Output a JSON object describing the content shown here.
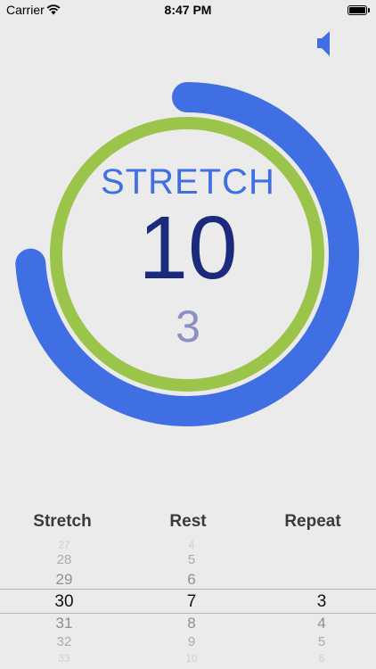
{
  "status_bar": {
    "carrier": "Carrier",
    "time": "8:47 PM"
  },
  "timer": {
    "phase_label": "STRETCH",
    "count": "10",
    "repeat_count": "3",
    "progress_outer": 0.74,
    "progress_inner": 1.0
  },
  "colors": {
    "phase": "#3f6fe3",
    "count": "#1b2a7c",
    "repeat": "#8a90c2",
    "outer_ring": "#3f6fe3",
    "inner_ring": "#9bc44a",
    "speaker": "#3f6fe3"
  },
  "picker": {
    "headers": {
      "stretch": "Stretch",
      "rest": "Rest",
      "repeat": "Repeat"
    },
    "stretch": {
      "above3": "27",
      "above2": "28",
      "above1": "29",
      "selected": "30",
      "below1": "31",
      "below2": "32",
      "below3": "33"
    },
    "rest": {
      "above3": "4",
      "above2": "5",
      "above1": "6",
      "selected": "7",
      "below1": "8",
      "below2": "9",
      "below3": "10"
    },
    "repeat": {
      "selected": "3",
      "below1": "4",
      "below2": "5",
      "below3": "6"
    }
  }
}
